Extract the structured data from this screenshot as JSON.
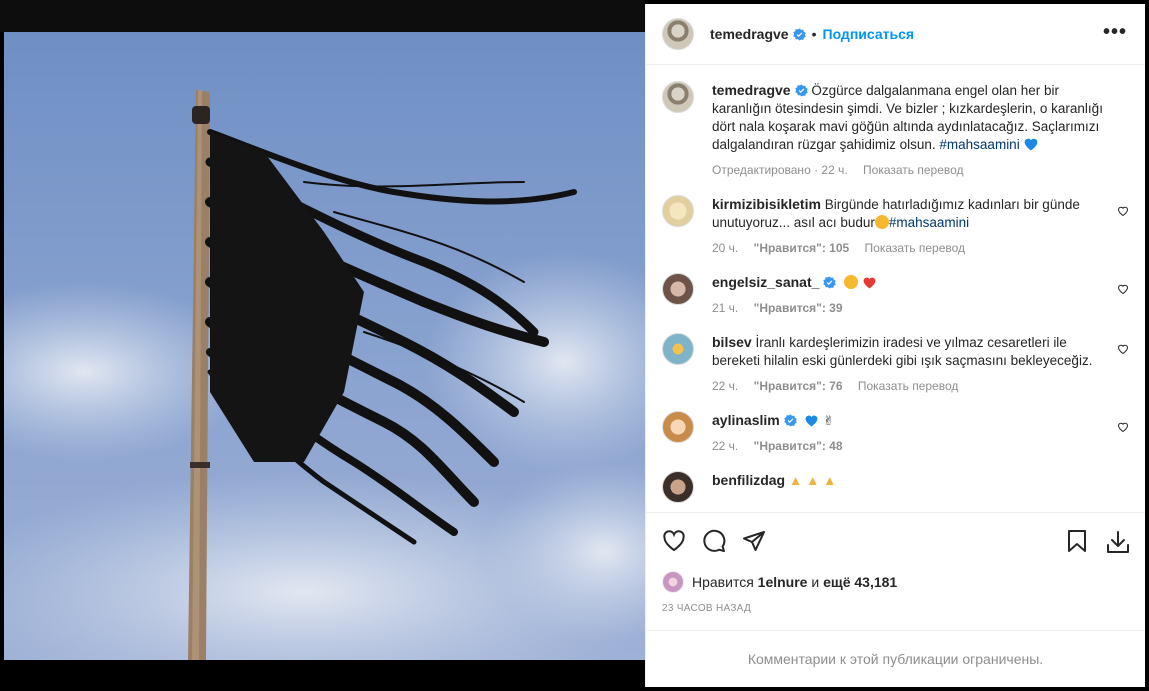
{
  "post": {
    "author": "temedragve",
    "follow_label": "Подписаться",
    "dot": "•",
    "more_label": "•••"
  },
  "caption": {
    "author": "temedragve",
    "text": "Özgürce dalgalanmana engel olan her bir karanlığın ötesindesin şimdi. Ve bizler ; kızkardeşlerin, o karanlığı dört nala koşarak mavi göğün altında aydınlatacağız. Saçlarımızı dalgalandıran rüzgar şahidimiz olsun.",
    "hashtag": "#mahsaamini",
    "edited": "Отредактировано · 22 ч.",
    "translate": "Показать перевод"
  },
  "comments": [
    {
      "user": "kirmizibisikletim",
      "text": "Birgünde hatırladığımız kadınları bir günde unutuyoruz... asıl acı budur",
      "hashtag": "#mahsaamini",
      "time": "20 ч.",
      "likes": "\"Нравится\": 105",
      "translate": "Показать перевод"
    },
    {
      "user": "engelsiz_sanat_",
      "text": "",
      "time": "21 ч.",
      "likes": "\"Нравится\": 39"
    },
    {
      "user": "bilsev",
      "text": "İranlı kardeşlerimizin iradesi ve yılmaz cesaretleri ile bereketi hilalin eski günlerdeki gibi ışık saçmasını bekleyeceğiz.",
      "time": "22 ч.",
      "likes": "\"Нравится\": 76",
      "translate": "Показать перевод"
    },
    {
      "user": "aylinaslim",
      "text": "",
      "time": "22 ч.",
      "likes": "\"Нравится\": 48"
    },
    {
      "user": "benfilizdag",
      "text": ""
    }
  ],
  "likes": {
    "prefix": "Нравится",
    "user": "1elnure",
    "middle": "и",
    "count": "ещё 43,181"
  },
  "timestamp": "23 часов назад",
  "footer": "Комментарии к этой публикации ограничены.",
  "colors": {
    "accent": "#0095f6",
    "verified": "#3897f0",
    "muted": "#8e8e8e",
    "hashtag": "#00376b"
  },
  "icons": [
    "heart-icon",
    "comment-icon",
    "share-icon",
    "bookmark-icon",
    "download-icon",
    "more-icon",
    "verified-icon"
  ]
}
